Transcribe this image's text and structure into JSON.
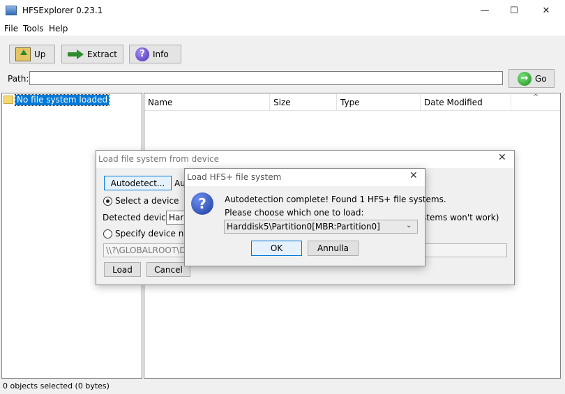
{
  "window": {
    "title": "HFSExplorer 0.23.1",
    "minimize_glyph": "—",
    "maximize_glyph": "☐",
    "close_glyph": "✕"
  },
  "menu": {
    "items": [
      "File",
      "Tools",
      "Help"
    ]
  },
  "toolbar": {
    "up_label": "Up",
    "extract_label": "Extract",
    "info_label": "Info",
    "info_glyph": "?"
  },
  "path": {
    "label": "Path:",
    "value": "",
    "go_label": "Go",
    "go_glyph": "→"
  },
  "tree": {
    "root_label": "No file system loaded"
  },
  "file_list": {
    "columns": [
      "Name",
      "Size",
      "Type",
      "Date Modified"
    ],
    "sort_glyph": "^"
  },
  "status": {
    "text": "0 objects selected (0 bytes)"
  },
  "device_dialog": {
    "title": "Load file system from device",
    "close_glyph": "✕",
    "autodetect_label": "Autodetect...",
    "autodetect_partial": "Aut",
    "select_device_label": "Select a device",
    "detected_label": "Detected devices:",
    "detected_value": "Hard",
    "detected_note": "stems won't work)",
    "specify_label": "Specify device name",
    "device_name_value": "\\\\?\\GLOBALROOT\\Device",
    "load_label": "Load",
    "cancel_label": "Cancel"
  },
  "hfs_dialog": {
    "title": "Load HFS+ file system",
    "close_glyph": "✕",
    "icon_glyph": "?",
    "message": "Autodetection complete! Found 1 HFS+ file systems.",
    "prompt": "Please choose which one to load:",
    "selected_option": "Harddisk5\\Partition0[MBR:Partition0]",
    "chevron_glyph": "⌄",
    "ok_label": "OK",
    "cancel_label": "Annulla"
  },
  "icons": {
    "app": "app-icon",
    "up": "up-folder-icon",
    "extract": "extract-arrow-icon",
    "info": "info-icon",
    "go": "go-arrow-icon",
    "tree_folder": "folder-icon",
    "question": "question-icon"
  }
}
